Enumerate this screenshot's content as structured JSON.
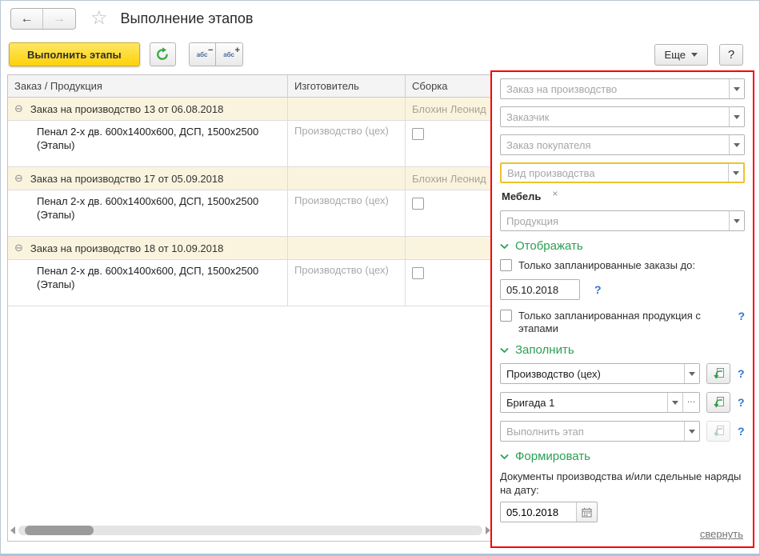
{
  "window": {
    "title": "Выполнение этапов"
  },
  "icons": {
    "back": "←",
    "forward": "→",
    "star": "☆",
    "collapse_row": "⊖",
    "abc": "абс",
    "minus": "−",
    "plus": "+",
    "ellipsis": "…"
  },
  "toolbar": {
    "execute_button": "Выполнить этапы",
    "more_button": "Еще",
    "help_button": "?"
  },
  "table": {
    "columns": [
      "Заказ / Продукция",
      "Изготовитель",
      "Сборка"
    ],
    "groups": [
      {
        "label": "Заказ на производство 13 от 06.08.2018",
        "assembler": "Блохин Леонид",
        "product": {
          "name": "Пенал 2-х дв. 600х1400х600, ДСП, 1500х2500 (Этапы)",
          "manufacturer": "Производство (цех)",
          "checked": false
        }
      },
      {
        "label": "Заказ на производство 17 от 05.09.2018",
        "assembler": "Блохин Леонид",
        "product": {
          "name": "Пенал 2-х дв. 600х1400х600, ДСП, 1500х2500 (Этапы)",
          "manufacturer": "Производство (цех)",
          "checked": false
        }
      },
      {
        "label": "Заказ на производство 18 от 10.09.2018",
        "assembler": "",
        "product": {
          "name": "Пенал 2-х дв. 600х1400х600, ДСП, 1500х2500 (Этапы)",
          "manufacturer": "Производство (цех)",
          "checked": false
        }
      }
    ]
  },
  "panel": {
    "order_placeholder": "Заказ на производство",
    "customer_placeholder": "Заказчик",
    "customer_order_placeholder": "Заказ покупателя",
    "production_type_placeholder": "Вид производства",
    "production_type_tag": "Мебель",
    "tag_remove": "×",
    "product_placeholder": "Продукция",
    "display": {
      "title": "Отображать",
      "only_planned_orders": "Только запланированные заказы до:",
      "orders_date": "05.10.2018",
      "only_planned_products": "Только запланированная продукция с этапами",
      "help": "?"
    },
    "fill": {
      "title": "Заполнить",
      "manufacturer_value": "Производство (цех)",
      "brigade_value": "Бригада 1",
      "stage_placeholder": "Выполнить этап",
      "help": "?"
    },
    "form": {
      "title": "Формировать",
      "label": "Документы производства и/или сдельные наряды на дату:",
      "date": "05.10.2018"
    },
    "collapse_link": "свернуть"
  }
}
